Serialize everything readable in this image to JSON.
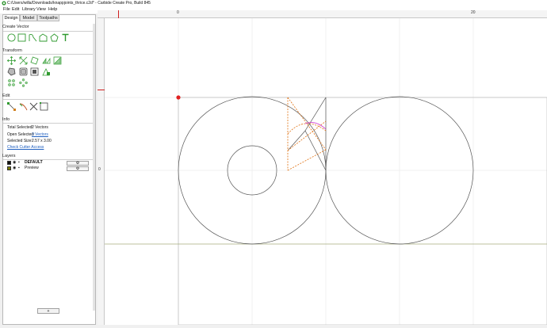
{
  "window": {
    "title": "C:/Users/willa/Downloads/knappjoints_thrice.c2d* - Carbide Create Pro, Build 845"
  },
  "menu": [
    "File",
    "Edit",
    "Library",
    "View",
    "Help"
  ],
  "tabs": [
    "Design",
    "Model",
    "Toolpaths"
  ],
  "sections": {
    "create_vector": "Create Vector",
    "transform": "Transform",
    "edit": "Edit",
    "info": "Info",
    "layers": "Layers"
  },
  "create_vector_tools": [
    "circle-icon",
    "rectangle-icon",
    "curve-icon",
    "polygon-icon",
    "pentagon-icon",
    "text-icon"
  ],
  "transform_tools": [
    "move-icon",
    "scale-icon",
    "rotate-icon",
    "mirror-icon",
    "align-icon",
    "weld-icon",
    "boolean-icon",
    "offset-icon",
    "inset-icon",
    "array-icon",
    "radial-array-icon"
  ],
  "edit_tools": [
    "node-edit-icon",
    "trim-icon",
    "cut-icon",
    "bounding-box-icon"
  ],
  "info": {
    "total_selected_label": "Total Selected:",
    "total_selected_value": "2 Vectors",
    "open_selected_label": "Open Selected:",
    "open_selected_value": "3 Vectors",
    "selected_size_label": "Selected Size:",
    "selected_size_value": "2.57 x 3.00",
    "check_cutter": "Check Cutter Access"
  },
  "layers": [
    {
      "name": "DEFAULT",
      "color": "#111111",
      "bold": true
    },
    {
      "name": "Preview",
      "color": "#7a7a00",
      "bold": false
    }
  ],
  "add_layer_label": "+",
  "ruler": {
    "top_labels": [
      "0",
      "20"
    ],
    "left_labels": [
      "0"
    ]
  },
  "colors": {
    "toolpath": "#e07010",
    "selection": "#d040d0",
    "baseline": "#aab080",
    "origin": "#e02020"
  }
}
